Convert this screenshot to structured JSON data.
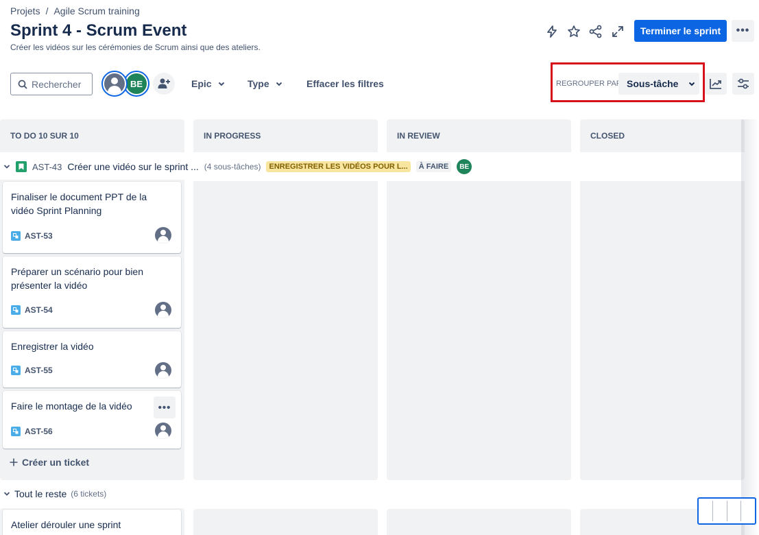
{
  "breadcrumb": {
    "root": "Projets",
    "separator": "/",
    "project": "Agile Scrum training"
  },
  "header": {
    "title": "Sprint 4 - Scrum Event",
    "subtitle": "Créer les vidéos sur les cérémonies de Scrum ainsi que des ateliers.",
    "complete_sprint_label": "Terminer le sprint"
  },
  "toolbar": {
    "search_placeholder": "Rechercher",
    "avatar_initials": "BE",
    "filters": {
      "epic": "Epic",
      "type": "Type",
      "clear": "Effacer les filtres"
    },
    "group_by_label": "REGROUPER PAR",
    "group_by_value": "Sous-tâche"
  },
  "columns": [
    {
      "label": "TO DO 10 SUR 10"
    },
    {
      "label": "IN PROGRESS"
    },
    {
      "label": "IN REVIEW"
    },
    {
      "label": "CLOSED"
    }
  ],
  "swimlane": {
    "key": "AST-43",
    "title": "Créer une vidéo sur le sprint ...",
    "subtask_count": "(4 sous-tâches)",
    "epic_label": "ENREGISTRER LES VIDÉOS POUR L...",
    "status": "À FAIRE",
    "assignee": "BE"
  },
  "cards": [
    {
      "title": "Finaliser le document PPT de la vidéo Sprint Planning",
      "key": "AST-53"
    },
    {
      "title": "Préparer un scénario pour bien présenter la vidéo",
      "key": "AST-54"
    },
    {
      "title": "Enregistrer la vidéo",
      "key": "AST-55"
    },
    {
      "title": "Faire le montage de la vidéo",
      "key": "AST-56"
    }
  ],
  "create_ticket_label": "Créer un ticket",
  "other_lane": {
    "title": "Tout le reste",
    "count": "(6 tickets)"
  },
  "other_card": {
    "title": "Atelier dérouler une sprint"
  },
  "colors": {
    "primary": "#0c66e4",
    "highlight_box": "#d6111b",
    "epic_lozenge": "#f8e6a0",
    "avatar_green": "#1f845a"
  }
}
